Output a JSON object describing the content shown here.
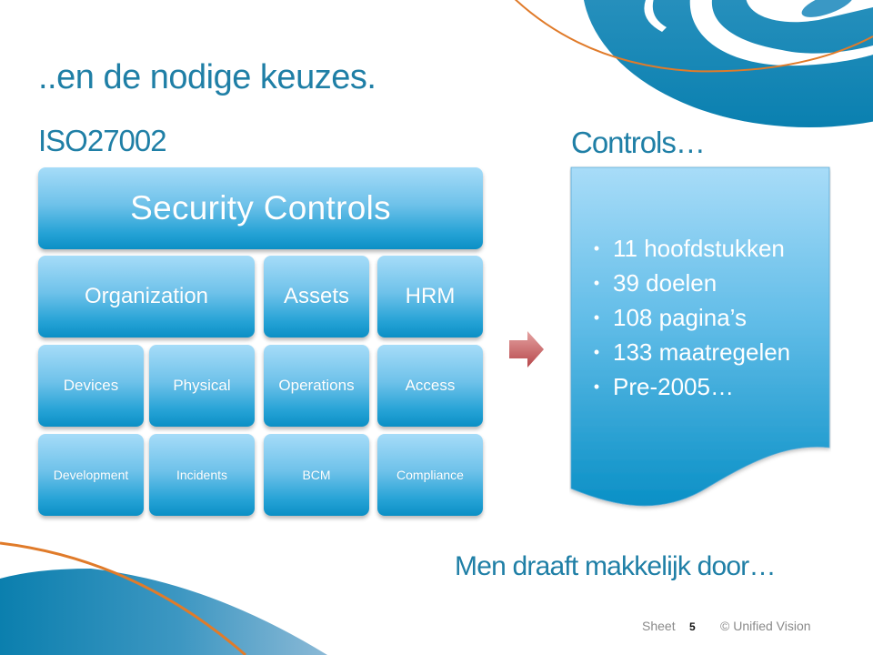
{
  "slide": {
    "title": "..en de nodige keuzes.",
    "subtitle": "ISO27002",
    "controls_heading": "Controls…",
    "tagline": "Men draaft makkelijk door…"
  },
  "diagram": {
    "header": "Security Controls",
    "row1": [
      "Organization",
      "Assets",
      "HRM"
    ],
    "row2": [
      "Devices",
      "Physical",
      "Operations",
      "Access"
    ],
    "row3": [
      "Development",
      "Incidents",
      "BCM",
      "Compliance"
    ]
  },
  "callout": {
    "bullet_glyph": "•",
    "items": [
      "11 hoofdstukken",
      "39 doelen",
      "108 pagina’s",
      "133 maatregelen",
      "Pre-2005…"
    ]
  },
  "footer": {
    "sheet_label": "Sheet",
    "sheet_number": "5",
    "copyright": "© Unified Vision"
  },
  "colors": {
    "heading_blue": "#1f7fa6",
    "tile_top": "#a6dcf8",
    "tile_bottom": "#0b8fc5",
    "logo_blue": "#1a86b5",
    "accent_orange": "#e07b2a",
    "arrow_red": "#c0585a"
  },
  "icons": {
    "arrow": "right-arrow-icon",
    "logo": "brand-logo-swirl"
  }
}
